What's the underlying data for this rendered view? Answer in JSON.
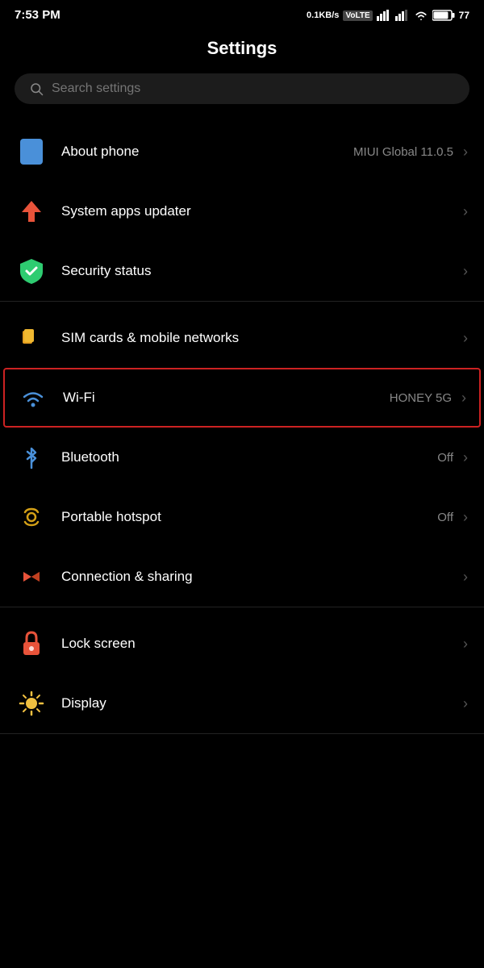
{
  "statusBar": {
    "time": "7:53 PM",
    "speed": "0.1KB/s",
    "networkLabel": "VoLTE",
    "batteryLevel": "77"
  },
  "pageTitle": "Settings",
  "search": {
    "placeholder": "Search settings"
  },
  "sections": [
    {
      "id": "system",
      "items": [
        {
          "id": "about-phone",
          "label": "About phone",
          "value": "MIUI Global 11.0.5",
          "icon": "phone"
        },
        {
          "id": "system-apps-updater",
          "label": "System apps updater",
          "value": "",
          "icon": "arrow-up"
        },
        {
          "id": "security-status",
          "label": "Security status",
          "value": "",
          "icon": "shield"
        }
      ]
    },
    {
      "id": "connectivity",
      "items": [
        {
          "id": "sim-cards",
          "label": "SIM cards & mobile networks",
          "value": "",
          "icon": "sim"
        },
        {
          "id": "wifi",
          "label": "Wi-Fi",
          "value": "HONEY 5G",
          "icon": "wifi",
          "highlighted": true
        },
        {
          "id": "bluetooth",
          "label": "Bluetooth",
          "value": "Off",
          "icon": "bluetooth"
        },
        {
          "id": "hotspot",
          "label": "Portable hotspot",
          "value": "Off",
          "icon": "hotspot"
        },
        {
          "id": "connection-sharing",
          "label": "Connection & sharing",
          "value": "",
          "icon": "connection"
        }
      ]
    },
    {
      "id": "personalization",
      "items": [
        {
          "id": "lock-screen",
          "label": "Lock screen",
          "value": "",
          "icon": "lock"
        },
        {
          "id": "display",
          "label": "Display",
          "value": "",
          "icon": "display"
        }
      ]
    }
  ]
}
